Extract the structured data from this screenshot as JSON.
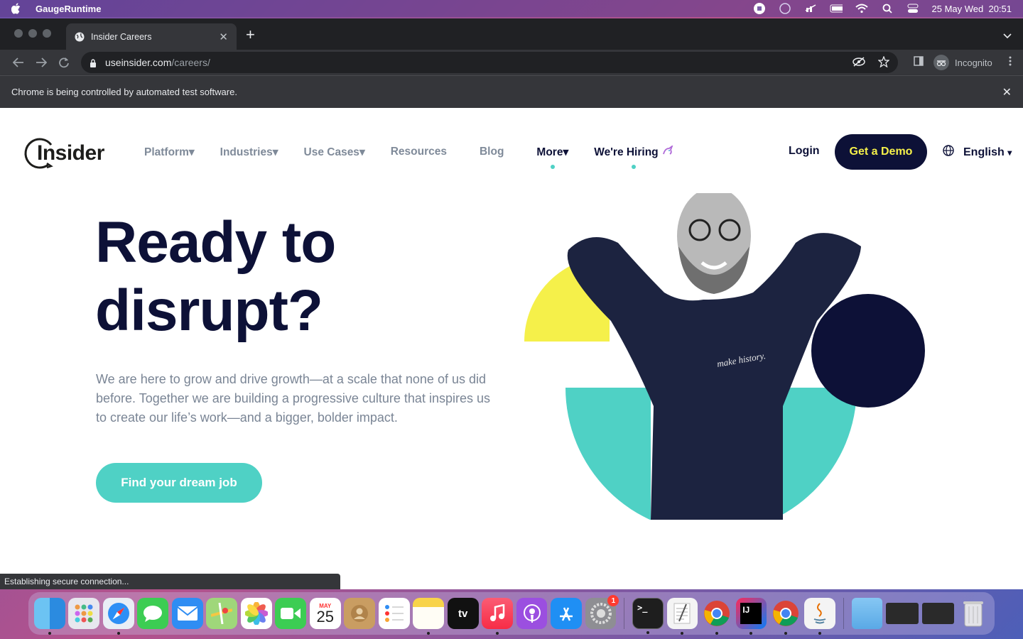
{
  "menubar": {
    "app_name": "GaugeRuntime",
    "datetime": "25 May Wed  20:51"
  },
  "browser": {
    "tab_title": "Insider Careers",
    "url_host": "useinsider.com",
    "url_path": "/careers/",
    "incognito_label": "Incognito",
    "infobar_text": "Chrome is being controlled by automated test software.",
    "status_text": "Establishing secure connection..."
  },
  "site": {
    "logo_text": "Insider",
    "nav": [
      {
        "label": "Platform",
        "caret": "▾"
      },
      {
        "label": "Industries",
        "caret": "▾"
      },
      {
        "label": "Use Cases",
        "caret": "▾"
      },
      {
        "label": "Resources"
      },
      {
        "label": "Blog"
      },
      {
        "label": "More",
        "caret": "▾"
      },
      {
        "label": "We're Hiring"
      }
    ],
    "login_label": "Login",
    "demo_label": "Get a Demo",
    "language_label": "English",
    "hero_title_line1": "Ready to",
    "hero_title_line2": "disrupt?",
    "hero_text": "We are here to grow and drive growth—at a scale that none of us did before. Together we are building a progressive culture that inspires us to create our life’s work—and a bigger, bolder impact.",
    "cta_label": "Find your dream job",
    "shirt_text": "make history."
  },
  "dock": {
    "calendar_month": "MAY",
    "calendar_day": "25",
    "tv_label": "tv",
    "settings_badge": "1",
    "intellij_label": "IJ"
  },
  "colors": {
    "navy": "#0d1137",
    "teal": "#4fd1c5",
    "yellow": "#f5f04a"
  }
}
